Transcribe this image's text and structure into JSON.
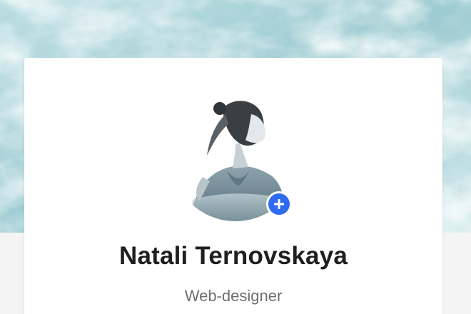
{
  "profile": {
    "name": "Natali Ternovskaya",
    "role": "Web-designer"
  },
  "cover": {
    "icon": "ocean-waves-photo"
  },
  "avatar": {
    "icon": "profile-photo",
    "add_icon": "plus-icon"
  },
  "colors": {
    "accent": "#2f6bf0",
    "name_text": "#1f1f1f",
    "role_text": "#6f6f6f",
    "card_bg": "#ffffff",
    "page_bg": "#f4f4f4"
  }
}
